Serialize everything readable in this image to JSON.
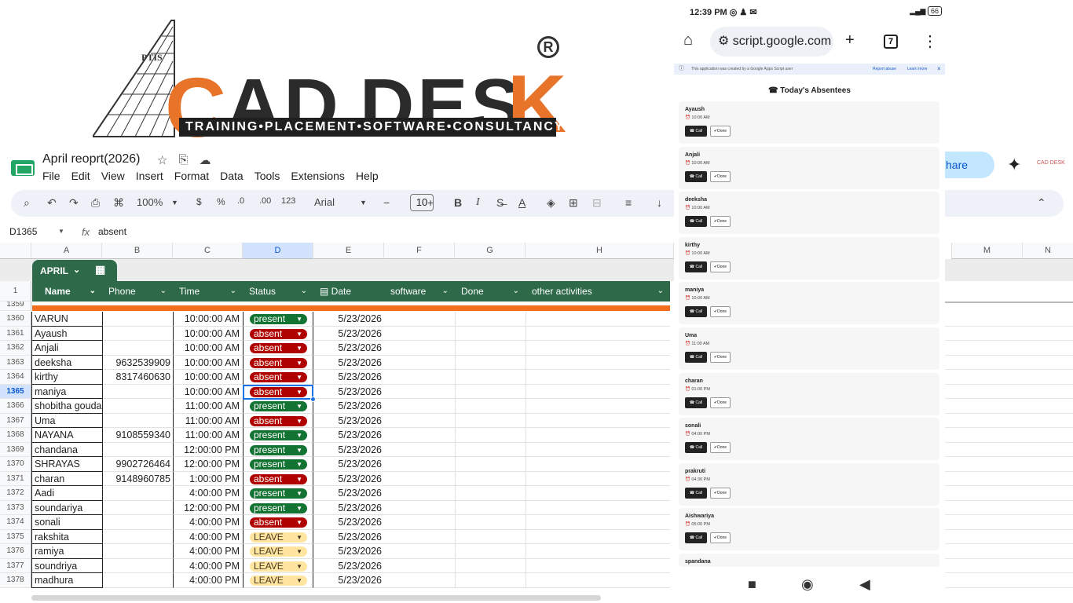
{
  "logo": {
    "word_c": "C",
    "word_ad": "AD",
    "word_desk": "DES",
    "word_k": "K",
    "tagline": "TRAINING•PLACEMENT•SOFTWARE•CONSULTANCY",
    "registered": "R",
    "ptis": "PTIS"
  },
  "doc": {
    "title": "April reoprt(2026)",
    "menu": [
      "File",
      "Edit",
      "View",
      "Insert",
      "Format",
      "Data",
      "Tools",
      "Extensions",
      "Help"
    ]
  },
  "toolbar": {
    "zoom": "100%",
    "currency": "$",
    "percent": "%",
    "dec_less": ".0",
    "dec_more": ".00",
    "num_fmt": "123",
    "font": "Arial",
    "font_size": "10",
    "bold": "B",
    "italic": "I"
  },
  "formula_bar": {
    "cell_ref": "D1365",
    "fx": "fx",
    "value": "absent"
  },
  "columns": [
    "A",
    "B",
    "C",
    "D",
    "E",
    "F",
    "G",
    "H"
  ],
  "columns_right": [
    "M",
    "N"
  ],
  "sheet_tab": {
    "label": "APRIL"
  },
  "table_header_row": "1",
  "table_headers": [
    "Name",
    "Phone",
    "Time",
    "Status",
    "Date",
    "software",
    "Done",
    "other activities"
  ],
  "partial_row": "1359",
  "rows": [
    {
      "num": "1360",
      "name": "VARUN",
      "phone": "",
      "time": "10:00:00 AM",
      "status": "present",
      "date": "5/23/2026"
    },
    {
      "num": "1361",
      "name": "Ayaush",
      "phone": "",
      "time": "10:00:00 AM",
      "status": "absent",
      "date": "5/23/2026"
    },
    {
      "num": "1362",
      "name": "Anjali",
      "phone": "",
      "time": "10:00:00 AM",
      "status": "absent",
      "date": "5/23/2026"
    },
    {
      "num": "1363",
      "name": "deeksha",
      "phone": "9632539909",
      "time": "10:00:00 AM",
      "status": "absent",
      "date": "5/23/2026"
    },
    {
      "num": "1364",
      "name": "kirthy",
      "phone": "8317460630",
      "time": "10:00:00 AM",
      "status": "absent",
      "date": "5/23/2026"
    },
    {
      "num": "1365",
      "name": "maniya",
      "phone": "",
      "time": "10:00:00 AM",
      "status": "absent",
      "date": "5/23/2026"
    },
    {
      "num": "1366",
      "name": "shobitha gouda",
      "phone": "",
      "time": "11:00:00 AM",
      "status": "present",
      "date": "5/23/2026"
    },
    {
      "num": "1367",
      "name": "Uma",
      "phone": "",
      "time": "11:00:00 AM",
      "status": "absent",
      "date": "5/23/2026"
    },
    {
      "num": "1368",
      "name": "NAYANA",
      "phone": "9108559340",
      "time": "11:00:00 AM",
      "status": "present",
      "date": "5/23/2026"
    },
    {
      "num": "1369",
      "name": "chandana",
      "phone": "",
      "time": "12:00:00 PM",
      "status": "present",
      "date": "5/23/2026"
    },
    {
      "num": "1370",
      "name": "SHRAYAS",
      "phone": "9902726464",
      "time": "12:00:00 PM",
      "status": "present",
      "date": "5/23/2026"
    },
    {
      "num": "1371",
      "name": "charan",
      "phone": "9148960785",
      "time": "1:00:00 PM",
      "status": "absent",
      "date": "5/23/2026"
    },
    {
      "num": "1372",
      "name": "Aadi",
      "phone": "",
      "time": "4:00:00 PM",
      "status": "present",
      "date": "5/23/2026"
    },
    {
      "num": "1373",
      "name": "soundariya",
      "phone": "",
      "time": "12:00:00 PM",
      "status": "present",
      "date": "5/23/2026"
    },
    {
      "num": "1374",
      "name": "sonali",
      "phone": "",
      "time": "4:00:00 PM",
      "status": "absent",
      "date": "5/23/2026"
    },
    {
      "num": "1375",
      "name": "rakshita",
      "phone": "",
      "time": "4:00:00 PM",
      "status": "LEAVE",
      "date": "5/23/2026"
    },
    {
      "num": "1376",
      "name": "ramiya",
      "phone": "",
      "time": "4:00:00 PM",
      "status": "LEAVE",
      "date": "5/23/2026"
    },
    {
      "num": "1377",
      "name": "soundriya",
      "phone": "",
      "time": "4:00:00 PM",
      "status": "LEAVE",
      "date": "5/23/2026"
    },
    {
      "num": "1378",
      "name": "madhura",
      "phone": "",
      "time": "4:00:00 PM",
      "status": "LEAVE",
      "date": "5/23/2026"
    }
  ],
  "share_label": "hare",
  "avatar_text": "CAD DESK",
  "phone": {
    "time": "12:39 PM",
    "battery": "66",
    "url": "script.google.com",
    "tab_count": "7",
    "info_text": "This application was created by a Google Apps Script user",
    "report_abuse": "Report abuse",
    "learn_more": "Learn more",
    "title": "Today's Absentees",
    "call_label": "Call",
    "done_label": "Done",
    "absentees": [
      {
        "name": "Ayaush",
        "time": "10:00 AM"
      },
      {
        "name": "Anjali",
        "time": "10:00 AM"
      },
      {
        "name": "deeksha",
        "time": "10:00 AM"
      },
      {
        "name": "kirthy",
        "time": "10:00 AM"
      },
      {
        "name": "maniya",
        "time": "10:00 AM"
      },
      {
        "name": "Uma",
        "time": "11:00 AM"
      },
      {
        "name": "charan",
        "time": "01:00 PM"
      },
      {
        "name": "sonali",
        "time": "04:00 PM"
      },
      {
        "name": "prakruti",
        "time": "04:30 PM"
      },
      {
        "name": "Aishwariya",
        "time": "05:00 PM"
      },
      {
        "name": "spandana",
        "time": ""
      }
    ]
  },
  "colors": {
    "header_green": "#2e6a4a",
    "present": "#137333",
    "absent": "#b10202",
    "leave": "#ffe5a0",
    "orange_band": "#f36f1e",
    "brand_orange": "#e8742a"
  }
}
